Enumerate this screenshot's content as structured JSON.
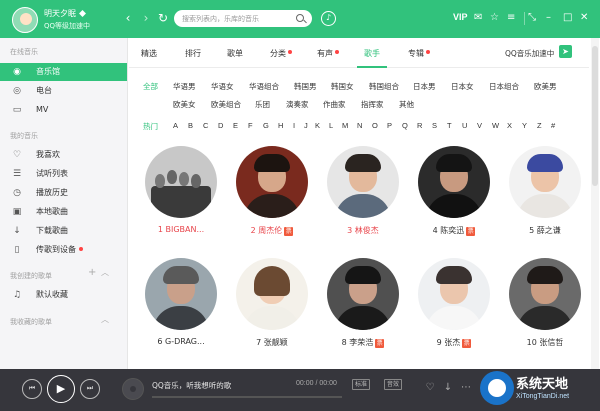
{
  "header": {
    "username": "明天夕眠",
    "level_text": "QQ等级加速中",
    "back_label": "‹",
    "forward_label": "›",
    "refresh_label": "↻",
    "search_placeholder": "搜索列表内，乐库的音乐",
    "vip_label": "VIP",
    "colors": {
      "brand": "#31c27c"
    }
  },
  "sidebar": {
    "online_title": "在线音乐",
    "online_items": [
      {
        "label": "音乐馆",
        "icon": "music-hall-icon",
        "active": true
      },
      {
        "label": "电台",
        "icon": "radio-icon"
      },
      {
        "label": "MV",
        "icon": "mv-icon"
      }
    ],
    "my_title": "我的音乐",
    "my_items": [
      {
        "label": "我喜欢",
        "icon": "heart-icon"
      },
      {
        "label": "试听列表",
        "icon": "list-icon"
      },
      {
        "label": "播放历史",
        "icon": "history-icon"
      },
      {
        "label": "本地歌曲",
        "icon": "computer-icon"
      },
      {
        "label": "下载歌曲",
        "icon": "download-icon"
      },
      {
        "label": "传歌到设备",
        "icon": "device-icon",
        "dot": true
      }
    ],
    "created_title": "我创建的歌单",
    "created_items": [
      {
        "label": "默认收藏",
        "icon": "playlist-icon"
      }
    ],
    "collected_title": "我收藏的歌单"
  },
  "tabs": [
    {
      "label": "精选"
    },
    {
      "label": "排行"
    },
    {
      "label": "歌单"
    },
    {
      "label": "分类",
      "dot": true
    },
    {
      "label": "有声",
      "dot": true
    },
    {
      "label": "歌手",
      "active": true
    },
    {
      "label": "专辑",
      "dot": true
    }
  ],
  "listen_together": "QQ音乐加速中",
  "filters": {
    "row1": [
      "全部",
      "华语男",
      "华语女",
      "华语组合",
      "韩国男",
      "韩国女",
      "韩国组合",
      "日本男",
      "日本女",
      "日本组合",
      "欧美男"
    ],
    "row2": [
      "欧美女",
      "欧美组合",
      "乐团",
      "演奏家",
      "作曲家",
      "指挥家",
      "其他"
    ],
    "selected": "全部"
  },
  "letters": [
    "热门",
    "A",
    "B",
    "C",
    "D",
    "E",
    "F",
    "G",
    "H",
    "I",
    "J",
    "K",
    "L",
    "M",
    "N",
    "O",
    "P",
    "Q",
    "R",
    "S",
    "T",
    "U",
    "V",
    "W",
    "X",
    "Y",
    "Z",
    "#"
  ],
  "singers": [
    {
      "name": "1 BIGBAN...",
      "highlight": true
    },
    {
      "name": "2 周杰伦",
      "highlight": true,
      "badge": "票"
    },
    {
      "name": "3 林俊杰",
      "highlight": true
    },
    {
      "name": "4 陈奕迅",
      "badge": "票"
    },
    {
      "name": "5 薛之谦"
    },
    {
      "name": "6 G-DRAG..."
    },
    {
      "name": "7 张靓颖"
    },
    {
      "name": "8 李荣浩",
      "badge": "票"
    },
    {
      "name": "9 张杰",
      "badge": "票"
    },
    {
      "name": "10 张信哲"
    }
  ],
  "player": {
    "prev_label": "⏮",
    "play_label": "▶",
    "next_label": "⏭",
    "title": "QQ音乐，听我想听的歌",
    "time": "00:00 / 00:00",
    "quality_label": "标准",
    "effect_label": "音效"
  },
  "watermark": {
    "text": "系统天地",
    "url": "XiTongTianDi.net"
  }
}
